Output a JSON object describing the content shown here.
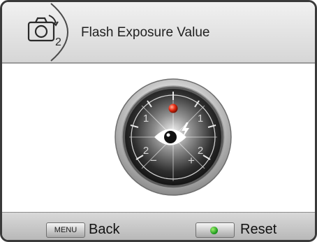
{
  "header": {
    "title": "Flash Exposure Value",
    "icon": "camera-mode-2-icon",
    "icon_text": "2"
  },
  "dial": {
    "icon": "eye-flash-icon",
    "indicator_color": "#e52a12",
    "scale_labels": [
      "1",
      "1",
      "2",
      "2"
    ],
    "minus_label": "−",
    "plus_label": "+",
    "current_value": 0
  },
  "footer": {
    "menu_badge": "MENU",
    "back_label": "Back",
    "reset_label": "Reset",
    "reset_dot_color": "#2eaa2e"
  }
}
